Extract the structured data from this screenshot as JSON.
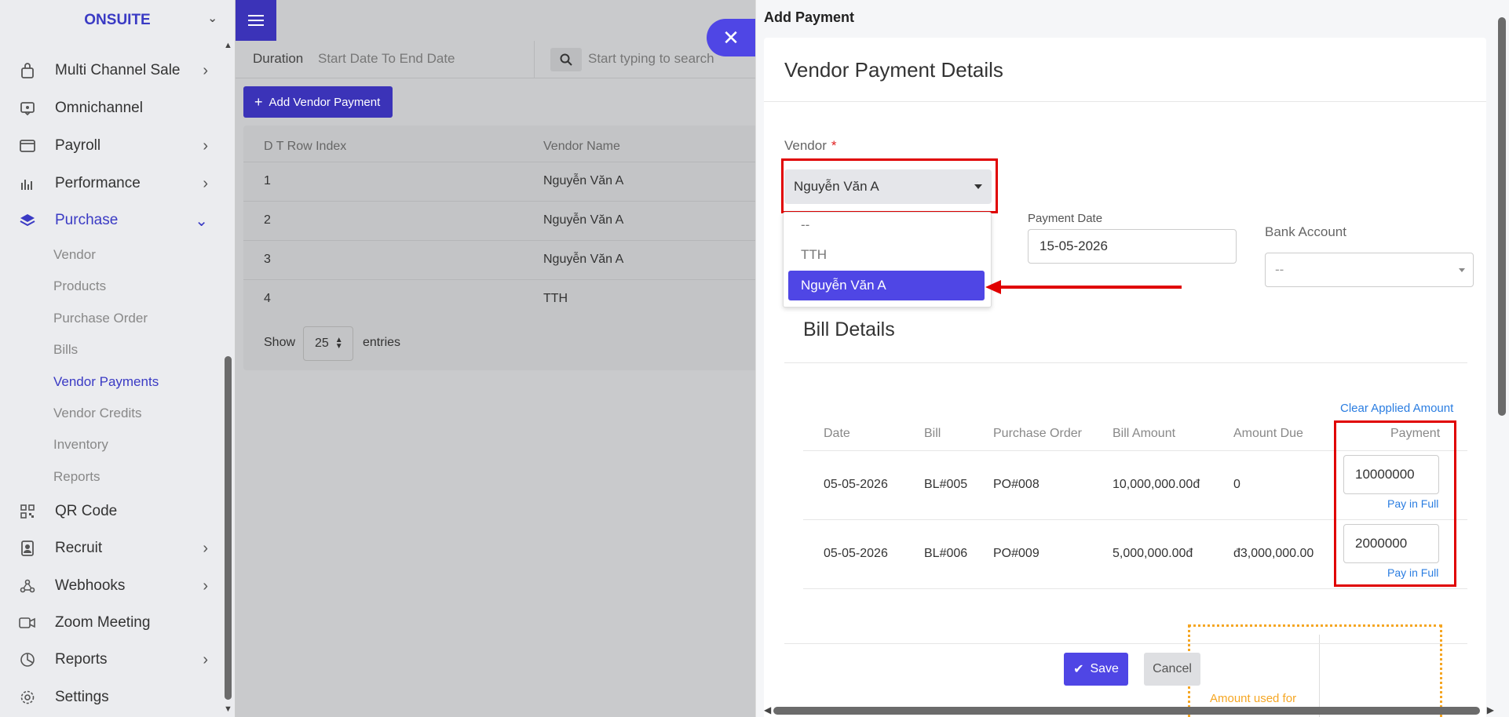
{
  "sidebar": {
    "brand": "ONSUITE",
    "items": [
      {
        "label": "Multi Channel Sale",
        "icon": "bag-icon"
      },
      {
        "label": "Omnichannel",
        "icon": "chat-icon"
      },
      {
        "label": "Payroll",
        "icon": "wallet-icon"
      },
      {
        "label": "Performance",
        "icon": "bar-chart-icon"
      },
      {
        "label": "Purchase",
        "icon": "layers-icon"
      },
      {
        "label": "QR Code",
        "icon": "qr-code-icon"
      },
      {
        "label": "Recruit",
        "icon": "badge-icon"
      },
      {
        "label": "Webhooks",
        "icon": "webhook-icon"
      },
      {
        "label": "Zoom Meeting",
        "icon": "video-icon"
      },
      {
        "label": "Reports",
        "icon": "pie-chart-icon"
      },
      {
        "label": "Settings",
        "icon": "gear-icon"
      }
    ],
    "purchase_sub": [
      "Vendor",
      "Products",
      "Purchase Order",
      "Bills",
      "Vendor Payments",
      "Vendor Credits",
      "Inventory",
      "Reports"
    ]
  },
  "main": {
    "duration_label": "Duration",
    "duration_value": "Start Date To End Date",
    "search_placeholder": "Start typing to search",
    "add_button": "Add Vendor Payment",
    "table": {
      "headers": [
        "D T Row Index",
        "Vendor Name"
      ],
      "rows": [
        [
          "1",
          "Nguyễn Văn A"
        ],
        [
          "2",
          "Nguyễn Văn A"
        ],
        [
          "3",
          "Nguyễn Văn A"
        ],
        [
          "4",
          "TTH"
        ]
      ]
    },
    "show_label": "Show",
    "page_size": "25",
    "entries_label": "entries"
  },
  "drawer": {
    "title": "Add Payment",
    "card_title": "Vendor Payment Details",
    "vendor_label": "Vendor",
    "required_mark": "*",
    "vendor_selected": "Nguyễn Văn A",
    "vendor_options": [
      "--",
      "TTH",
      "Nguyễn Văn A"
    ],
    "payment_date_label": "Payment Date",
    "payment_date_value": "15-05-2026",
    "bank_account_label": "Bank Account",
    "bank_account_value": "--",
    "bill_details_title": "Bill Details",
    "clear_applied": "Clear Applied Amount",
    "bill_headers": [
      "Date",
      "Bill",
      "Purchase Order",
      "Bill Amount",
      "Amount Due",
      "Payment"
    ],
    "bills": [
      {
        "date": "05-05-2026",
        "bill": "BL#005",
        "po": "PO#008",
        "amount": "10,000,000.00đ",
        "due": "0",
        "payment": "10000000",
        "pay_full": "Pay in Full"
      },
      {
        "date": "05-05-2026",
        "bill": "BL#006",
        "po": "PO#009",
        "amount": "5,000,000.00đ",
        "due": "đ3,000,000.00",
        "payment": "2000000",
        "pay_full": "Pay in Full"
      }
    ],
    "amount_used": "Amount used for",
    "save": "Save",
    "cancel": "Cancel"
  },
  "colors": {
    "accent": "#4f46e5",
    "highlight": "#e00000",
    "link": "#2a7de1",
    "warning": "#f5a623"
  }
}
